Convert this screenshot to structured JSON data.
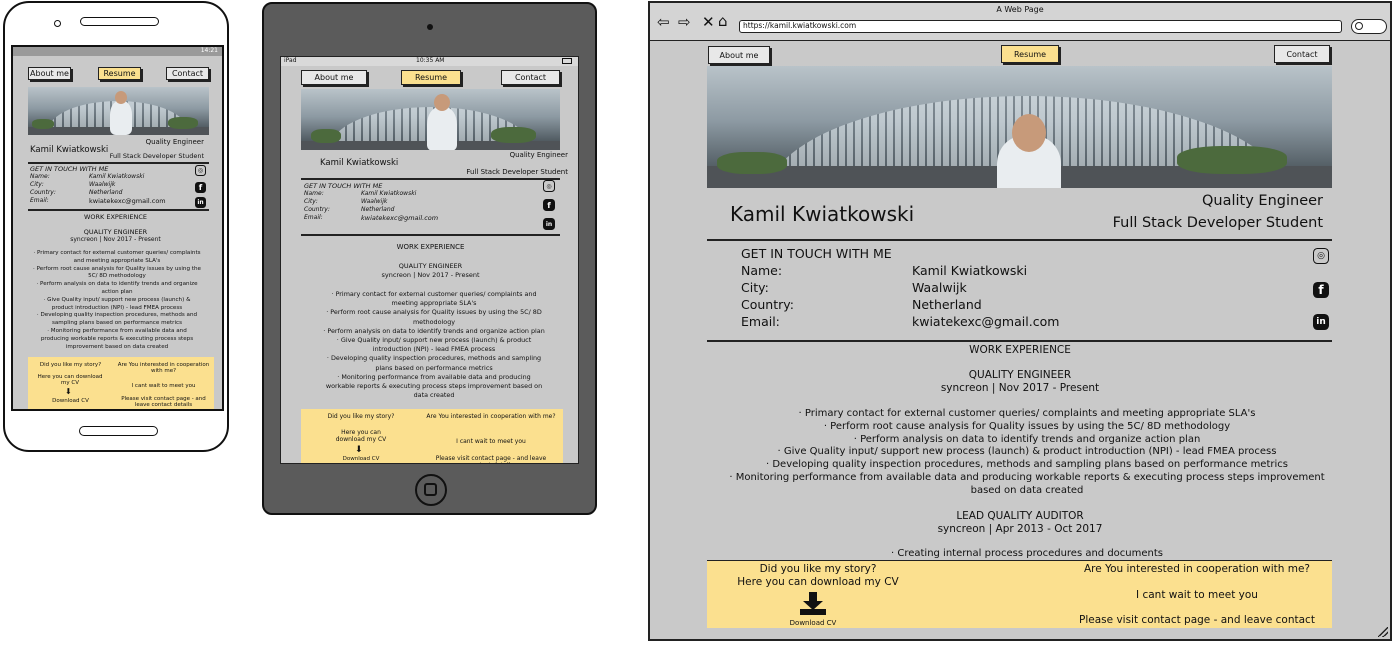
{
  "nav": {
    "about": "About me",
    "resume": "Resume",
    "contact": "Contact"
  },
  "profile": {
    "name": "Kamil Kwiatkowski",
    "role1": "Quality Engineer",
    "role2": "Full Stack Developer Student"
  },
  "contact": {
    "heading": "GET IN TOUCH WITH ME",
    "name_label": "Name:",
    "name_value": "Kamil Kwiatkowski",
    "city_label": "City:",
    "city_value": "Waalwijk",
    "country_label": "Country:",
    "country_value": "Netherland",
    "email_label": "Email:",
    "email_value": "kwiatekexc@gmail.com"
  },
  "experience": {
    "heading": "WORK EXPERIENCE",
    "job1_title": "QUALITY ENGINEER",
    "job1_period": "syncreon | Nov 2017 - Present",
    "job1_items": [
      "Primary contact for external customer queries/ complaints and meeting appropriate SLA's",
      "Perform root cause analysis for Quality issues by using the 5C/ 8D methodology",
      "Perform analysis on data to identify trends and organize action plan",
      "Give Quality input/ support new process (launch) & product introduction (NPI) - lead FMEA process",
      "Developing quality inspection procedures, methods and sampling plans based on performance metrics",
      "Monitoring performance from available data and producing workable reports & executing process steps improvement based on data created"
    ],
    "job2_title": "LEAD QUALITY AUDITOR",
    "job2_period": "syncreon | Apr 2013 - Oct 2017",
    "job2_items": [
      "Creating internal process procedures and documents"
    ]
  },
  "footer": {
    "story": "Did you like my story?",
    "download": "Here you can download my CV",
    "download_label": "Download CV",
    "coop": "Are You interested in cooperation with me?",
    "meet": "I cant wait to meet you",
    "visit": "Please visit contact page - and leave contact",
    "visit_short": "Please visit contact page - and leave contact details"
  },
  "browser": {
    "title": "A Web Page",
    "url": "https://kamil.kwiatkowski.com"
  },
  "tablet_status": {
    "carrier": "iPad",
    "time": "10:35 AM"
  },
  "phone_status": {
    "time": "14:21"
  },
  "colors": {
    "accent": "#fbe08f",
    "panel": "#c9c9c9",
    "frame": "#222222",
    "tablet_body": "#5b5b5b"
  }
}
